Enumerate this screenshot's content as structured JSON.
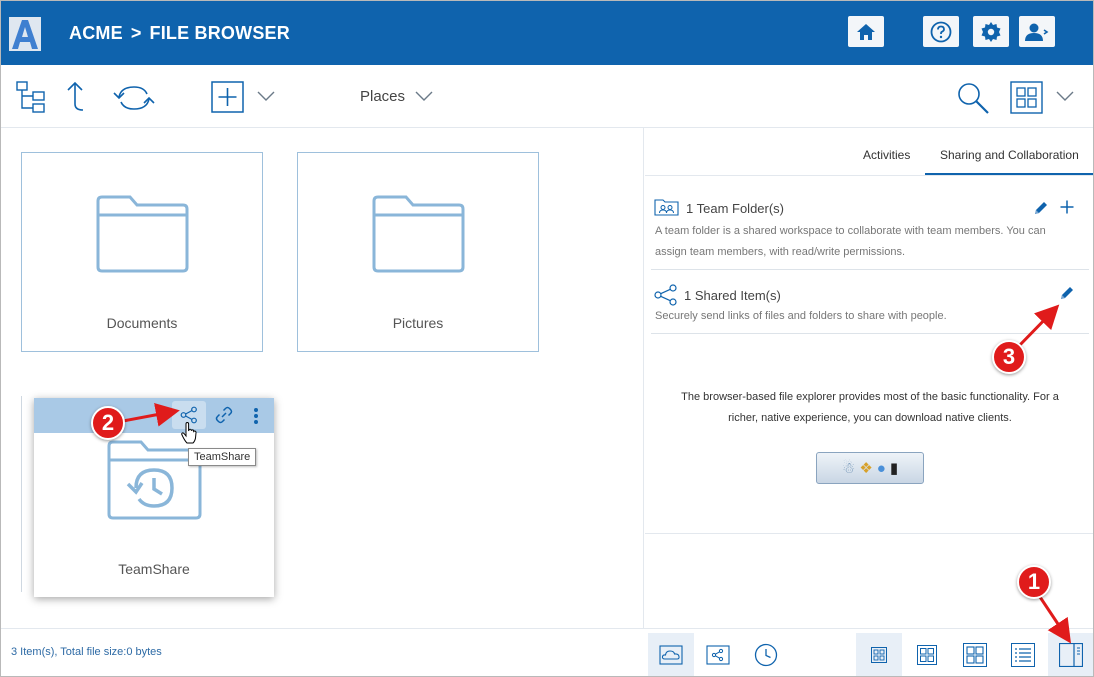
{
  "header": {
    "logo_letter": "A",
    "brand": "ACME",
    "separator": ">",
    "title": "FILE BROWSER"
  },
  "toolbar": {
    "places_label": "Places"
  },
  "folders": [
    {
      "label": "Documents"
    },
    {
      "label": "Pictures"
    },
    {
      "label": "TeamShare"
    }
  ],
  "tooltip": "TeamShare",
  "panel": {
    "tabs": [
      "Activities",
      "Sharing and Collaboration"
    ],
    "active_tab": "Sharing and Collaboration",
    "team_folders": {
      "title": "1 Team Folder(s)",
      "desc_line1": "A team folder is a shared workspace to collaborate with team members. You can",
      "desc_line2": "assign team members, with read/write permissions."
    },
    "shared_items": {
      "title": "1 Shared Item(s)",
      "desc": "Securely send links of files and folders to share with people."
    },
    "info_line1": "The browser-based file explorer provides most of the basic functionality. For a",
    "info_line2": "richer, native experience, you can download native clients."
  },
  "status": {
    "text": "3 Item(s), Total file size:0 bytes"
  },
  "callouts": [
    "1",
    "2",
    "3"
  ],
  "colors": {
    "header_bg": "#0f63ad",
    "accent": "#0f63ad",
    "folder_icon": "#8ab6d9",
    "callout": "#e01b1b",
    "status_text": "#2d6aa5"
  }
}
